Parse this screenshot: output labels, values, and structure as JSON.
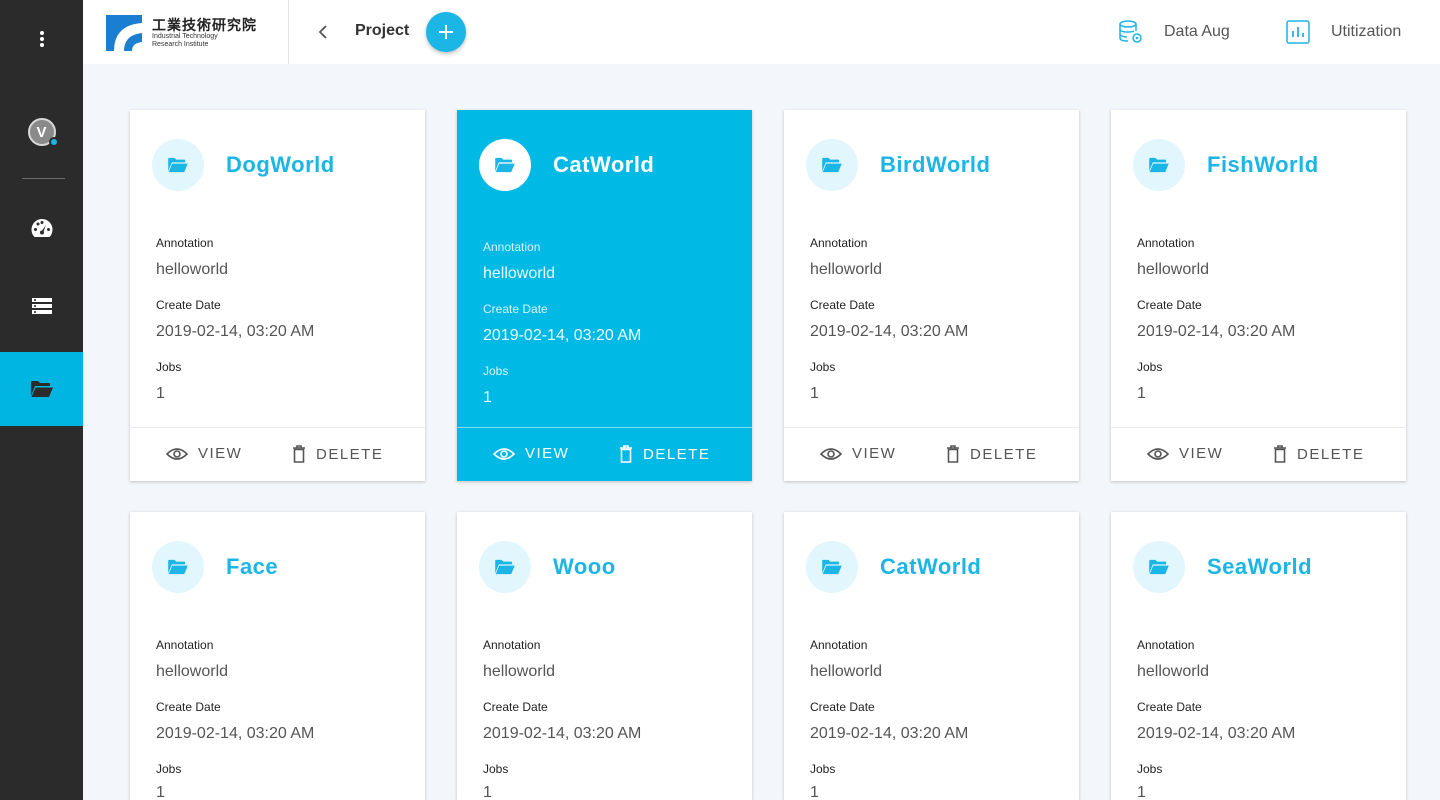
{
  "sidebar": {
    "avatar_letter": "V",
    "accent": "#00b5e2"
  },
  "header": {
    "logo": {
      "cn": "工業技術研究院",
      "en_line1": "Industrial Technology",
      "en_line2": "Research Institute"
    },
    "breadcrumb": "Project",
    "links": {
      "data_aug": "Data Aug",
      "utilization": "Utitization"
    }
  },
  "labels": {
    "annotation": "Annotation",
    "create_date": "Create Date",
    "jobs": "Jobs",
    "view": "VIEW",
    "delete": "DELETE"
  },
  "projects": [
    {
      "name": "DogWorld",
      "annotation": "helloworld",
      "create_date": "2019-02-14, 03:20 AM",
      "jobs": "1"
    },
    {
      "name": "CatWorld",
      "annotation": "helloworld",
      "create_date": "2019-02-14, 03:20 AM",
      "jobs": "1",
      "active": true
    },
    {
      "name": "BirdWorld",
      "annotation": "helloworld",
      "create_date": "2019-02-14, 03:20 AM",
      "jobs": "1"
    },
    {
      "name": "FishWorld",
      "annotation": "helloworld",
      "create_date": "2019-02-14, 03:20 AM",
      "jobs": "1"
    },
    {
      "name": "Face",
      "annotation": "helloworld",
      "create_date": "2019-02-14, 03:20 AM",
      "jobs": "1"
    },
    {
      "name": "Wooo",
      "annotation": "helloworld",
      "create_date": "2019-02-14, 03:20 AM",
      "jobs": "1"
    },
    {
      "name": "CatWorld",
      "annotation": "helloworld",
      "create_date": "2019-02-14, 03:20 AM",
      "jobs": "1"
    },
    {
      "name": "SeaWorld",
      "annotation": "helloworld",
      "create_date": "2019-02-14, 03:20 AM",
      "jobs": "1"
    }
  ],
  "colors": {
    "accent": "#1bb5e6",
    "active_card": "#00b9e4",
    "sidebar_bg": "#2b2b2b",
    "page_bg": "#f3f6fa"
  }
}
